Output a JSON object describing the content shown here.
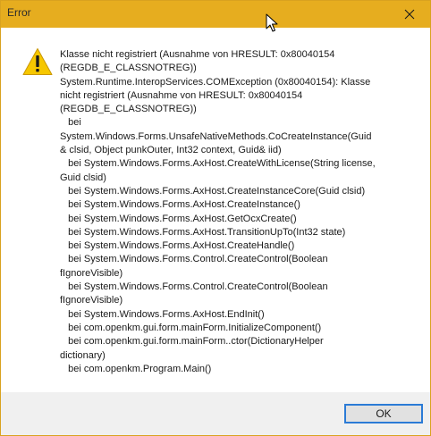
{
  "window": {
    "title": "Error",
    "close_icon": "close-icon"
  },
  "dialog": {
    "icon": "warning-icon",
    "message_lines": [
      "Klasse nicht registriert (Ausnahme von HRESULT: 0x80040154",
      "(REGDB_E_CLASSNOTREG))",
      "System.Runtime.InteropServices.COMException (0x80040154): Klasse",
      "nicht registriert (Ausnahme von HRESULT: 0x80040154",
      "(REGDB_E_CLASSNOTREG))",
      "   bei",
      "System.Windows.Forms.UnsafeNativeMethods.CoCreateInstance(Guid",
      "& clsid, Object punkOuter, Int32 context, Guid& iid)",
      "   bei System.Windows.Forms.AxHost.CreateWithLicense(String license,",
      "Guid clsid)",
      "   bei System.Windows.Forms.AxHost.CreateInstanceCore(Guid clsid)",
      "   bei System.Windows.Forms.AxHost.CreateInstance()",
      "   bei System.Windows.Forms.AxHost.GetOcxCreate()",
      "   bei System.Windows.Forms.AxHost.TransitionUpTo(Int32 state)",
      "   bei System.Windows.Forms.AxHost.CreateHandle()",
      "   bei System.Windows.Forms.Control.CreateControl(Boolean",
      "fIgnoreVisible)",
      "   bei System.Windows.Forms.Control.CreateControl(Boolean",
      "fIgnoreVisible)",
      "   bei System.Windows.Forms.AxHost.EndInit()",
      "   bei com.openkm.gui.form.mainForm.InitializeComponent()",
      "   bei com.openkm.gui.form.mainForm..ctor(DictionaryHelper",
      "dictionary)",
      "   bei com.openkm.Program.Main()"
    ],
    "ok_label": "OK"
  },
  "colors": {
    "titlebar": "#e6ad1f",
    "window_border": "#d9a21f",
    "footer": "#f0f0f0",
    "button_border": "#2b7bd6",
    "warning_fill": "#f6c700"
  }
}
